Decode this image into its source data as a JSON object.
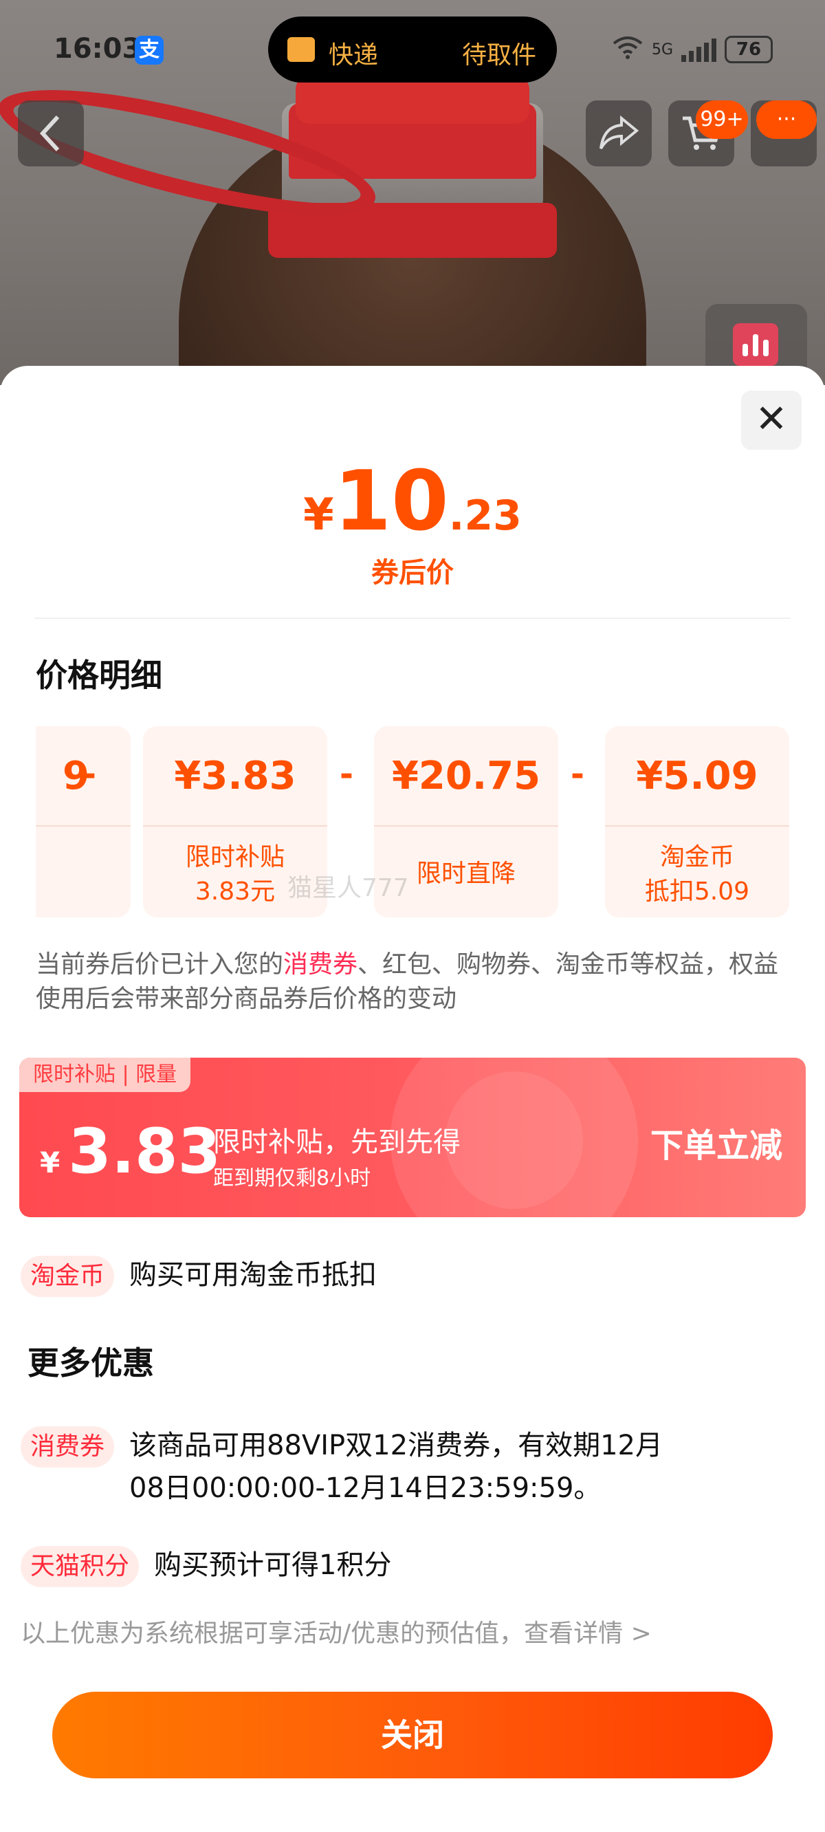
{
  "status_bar": {
    "time": "16:03",
    "alipay_glyph": "支",
    "island_left": "快递",
    "island_right": "待取件",
    "network": "5G",
    "battery": "76"
  },
  "top_actions": {
    "cart_badge": "99+",
    "more_badge": "···"
  },
  "sheet": {
    "price": {
      "yen": "¥",
      "int": "10",
      "dec": ".23",
      "label": "券后价"
    },
    "breakdown_title": "价格明细",
    "cards": [
      {
        "value": "9",
        "desc": ""
      },
      {
        "value": "¥3.83",
        "desc": "限时补贴\n3.83元"
      },
      {
        "value": "¥20.75",
        "desc": "限时直降"
      },
      {
        "value": "¥5.09",
        "desc": "淘金币\n抵扣5.09"
      }
    ],
    "minus": "-",
    "watermark": "猫星人777",
    "note_pre": "当前券后价已计入您的",
    "note_hl": "消费券",
    "note_post": "、红包、购物券、淘金币等权益，权益使用后会带来部分商品券后价格的变动",
    "subsidy": {
      "tag": "限时补贴 | 限量",
      "yen": "¥",
      "amount": "3.83",
      "title": "限时补贴，先到先得",
      "subtitle": "距到期仅剩8小时",
      "cta": "下单立减"
    },
    "taojinbi": {
      "pill": "淘金币",
      "text": "购买可用淘金币抵扣"
    },
    "more_title": "更多优惠",
    "coupon": {
      "pill": "消费券",
      "line1": "该商品可用88VIP双12消费券，有效期12月",
      "line2": "08日00:00:00-12月14日23:59:59。"
    },
    "points": {
      "pill": "天猫积分",
      "text": "购买预计可得1积分"
    },
    "footnote": "以上优惠为系统根据可享活动/优惠的预估值，查看详情 >",
    "close_label": "关闭"
  }
}
